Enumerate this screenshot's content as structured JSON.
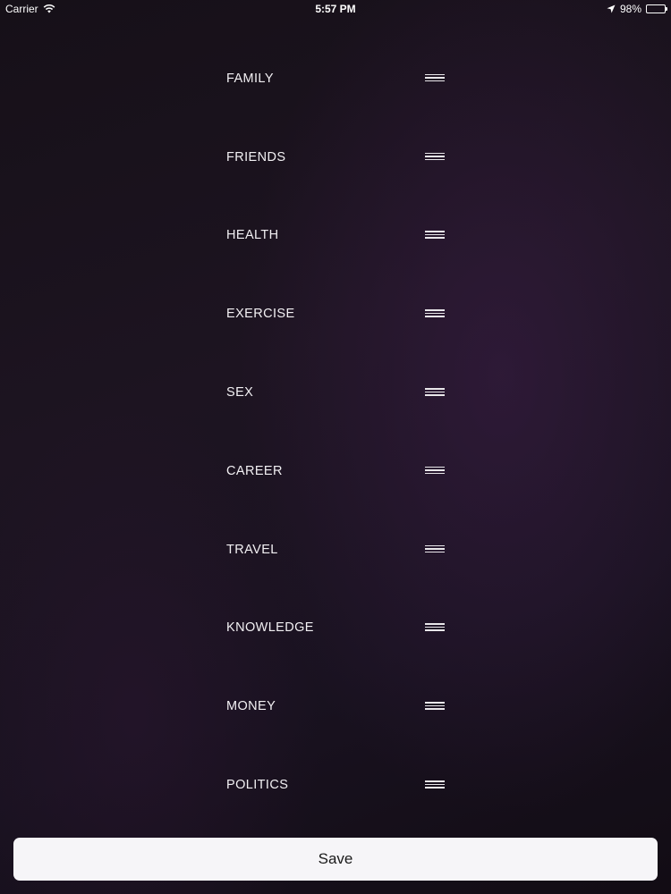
{
  "status_bar": {
    "carrier": "Carrier",
    "time": "5:57 PM",
    "battery_percent_label": "98%",
    "battery_level": 0.98,
    "icons": [
      "wifi-icon",
      "location-arrow-icon",
      "battery-icon"
    ]
  },
  "categories": [
    {
      "label": "FAMILY"
    },
    {
      "label": "FRIENDS"
    },
    {
      "label": "HEALTH"
    },
    {
      "label": "EXERCISE"
    },
    {
      "label": "SEX"
    },
    {
      "label": "CAREER"
    },
    {
      "label": "TRAVEL"
    },
    {
      "label": "KNOWLEDGE"
    },
    {
      "label": "MONEY"
    },
    {
      "label": "POLITICS"
    }
  ],
  "save_button": {
    "label": "Save"
  },
  "colors": {
    "background": "#140e16",
    "text": "#ffffff",
    "button_background": "#f6f5f8",
    "button_text": "#1a1a1a"
  }
}
